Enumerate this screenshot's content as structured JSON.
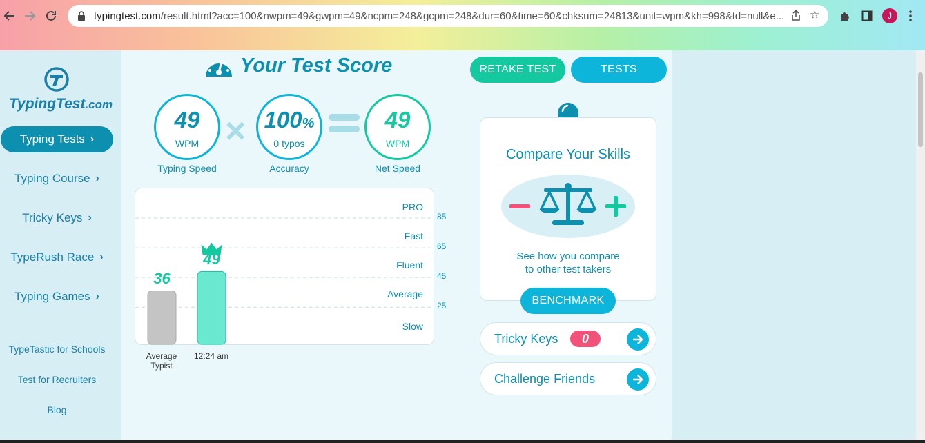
{
  "browser": {
    "url_host": "typingtest.com",
    "url_rest": "/result.html?acc=100&nwpm=49&gwpm=49&ncpm=248&gcpm=248&dur=60&time=60&chksum=24813&unit=wpm&kh=998&td=null&e...",
    "profile_initial": "J",
    "icons": [
      "back-arrow-icon",
      "forward-arrow-icon",
      "reload-icon",
      "lock-icon",
      "share-icon",
      "star-icon",
      "puzzle-icon",
      "side-panel-icon",
      "kebab-menu-icon"
    ]
  },
  "logo": {
    "name": "TypingTest",
    "suffix": ".com"
  },
  "sidebar": {
    "items": [
      {
        "label": "Typing Tests",
        "active": true
      },
      {
        "label": "Typing Course"
      },
      {
        "label": "Tricky Keys"
      },
      {
        "label": "TypeRush Race"
      },
      {
        "label": "Typing Games"
      }
    ],
    "links": [
      "TypeTastic for Schools",
      "Test for Recruiters",
      "Blog"
    ]
  },
  "score": {
    "title": "Your Test Score",
    "retake_label": "RETAKE TEST",
    "tests_label": "TESTS",
    "speed": {
      "value": "49",
      "unit": "WPM",
      "label": "Typing Speed"
    },
    "accuracy": {
      "value": "100",
      "pct": "%",
      "sub": "0  typos",
      "label": "Accuracy"
    },
    "net": {
      "value": "49",
      "unit": "WPM",
      "label": "Net Speed"
    },
    "times_symbol": "×"
  },
  "chart_data": {
    "type": "bar",
    "categories": [
      "Average Typist",
      "12:24 am"
    ],
    "category_lines": [
      [
        "Average",
        "Typist"
      ],
      [
        "12:24 am"
      ]
    ],
    "values": [
      36,
      49
    ],
    "value_labels": [
      "36",
      "49"
    ],
    "levels": [
      "PRO",
      "Fast",
      "Fluent",
      "Average",
      "Slow"
    ],
    "thresholds": [
      85,
      65,
      45,
      25
    ],
    "ylim": [
      0,
      105
    ],
    "colors": {
      "average": "#c4c4c4",
      "user": "#6be9d0",
      "accent": "#14c8a0"
    },
    "highlight_icon": "crown-icon"
  },
  "compare": {
    "title": "Compare Your Skills",
    "desc_lines": [
      "See how you compare",
      "to other test takers"
    ],
    "button_label": "BENCHMARK"
  },
  "links": {
    "tricky_keys_label": "Tricky Keys",
    "tricky_keys_count": "0",
    "challenge_label": "Challenge Friends"
  },
  "colors": {
    "primary": "#0d8fb0",
    "accent_blue": "#0eb5da",
    "accent_green": "#14c8a0",
    "badge_red": "#f0527a"
  }
}
